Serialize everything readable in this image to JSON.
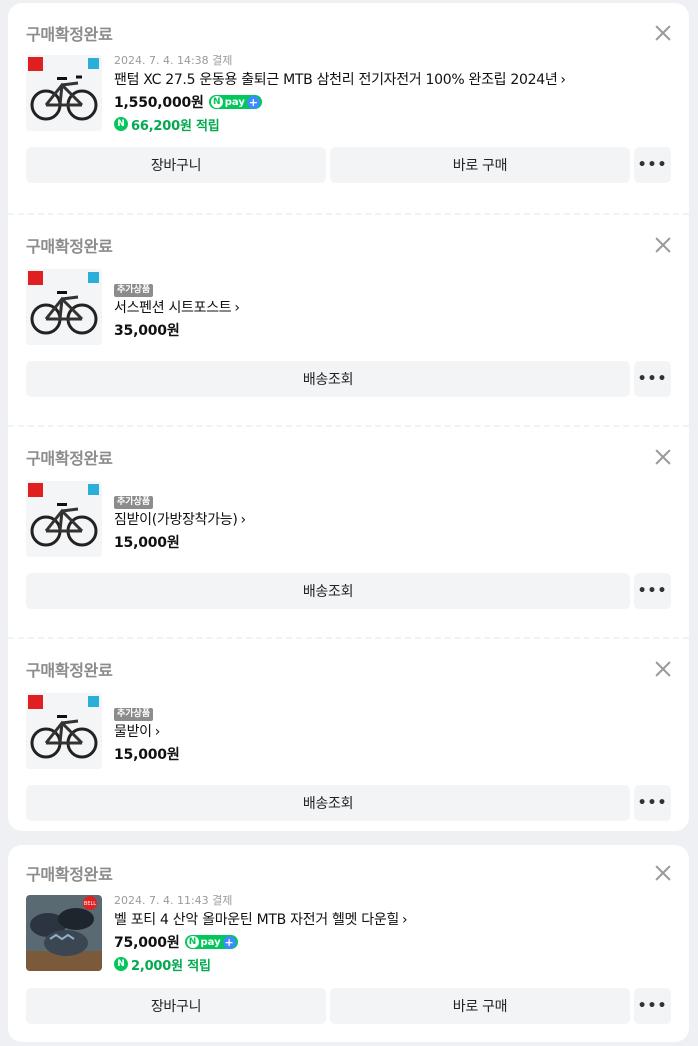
{
  "orders": [
    {
      "status": "구매확정완료",
      "meta": "2024. 7. 4. 14:38 결제",
      "tag": "",
      "title": "팬텀 XC 27.5 운동용 출퇴근 MTB 삼천리 전기자전거 100% 완조립 2024년",
      "price": "1,550,000원",
      "npay": "pay",
      "point": "66,200원 적립",
      "buttons": [
        "장바구니",
        "바로 구매"
      ]
    },
    {
      "status": "구매확정완료",
      "tag": "추가상품",
      "title": "서스펜션 시트포스트",
      "price": "35,000원",
      "buttons": [
        "배송조회"
      ]
    },
    {
      "status": "구매확정완료",
      "tag": "추가상품",
      "title": "짐받이(가방장착가능)",
      "price": "15,000원",
      "buttons": [
        "배송조회"
      ]
    },
    {
      "status": "구매확정완료",
      "tag": "추가상품",
      "title": "물받이",
      "price": "15,000원",
      "buttons": [
        "배송조회"
      ]
    },
    {
      "status": "구매확정완료",
      "meta": "2024. 7. 4. 11:43 결제",
      "title": "벨 포티 4 산악 올마운틴 MTB 자전거 헬멧 다운힐",
      "price": "75,000원",
      "npay": "pay",
      "point": "2,000원 적립",
      "buttons": [
        "장바구니",
        "바로 구매"
      ]
    }
  ],
  "icons": {
    "close": "close-icon",
    "chevron": "chevron-right-icon",
    "more": "more-icon",
    "point": "naver-point-icon",
    "npay": "naver-pay-icon"
  },
  "colors": {
    "status_text": "#8c8c8c",
    "npay_green": "#03c75a",
    "point_text": "#03a94f",
    "button_bg": "#f3f4f6"
  },
  "glyphs": {
    "chevron": "›",
    "more": "•••",
    "n": "N",
    "plus": "+",
    "bell": "BELL"
  }
}
